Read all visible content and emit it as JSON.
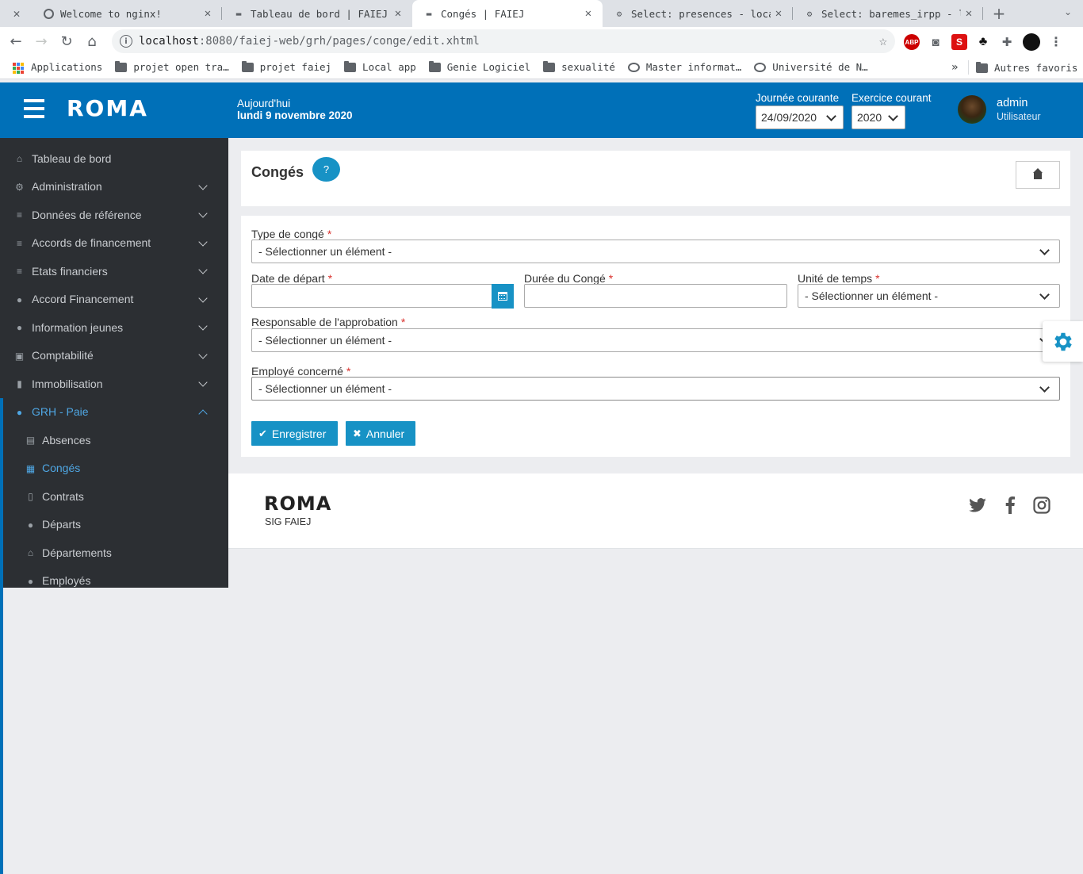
{
  "browser": {
    "tabs": [
      {
        "title": "Welcome to nginx!",
        "active": false
      },
      {
        "title": "Tableau de bord | FAIEJ",
        "active": false
      },
      {
        "title": "Congés | FAIEJ",
        "active": true
      },
      {
        "title": "Select: presences - local",
        "active": false
      },
      {
        "title": "Select: baremes_irpp - lo",
        "active": false
      }
    ],
    "url_host": "localhost",
    "url_rest": ":8080/faiej-web/grh/pages/conge/edit.xhtml",
    "bookmarks": [
      {
        "label": "Applications",
        "icon": "apps-icon"
      },
      {
        "label": "projet open tra…",
        "icon": "folder-icon"
      },
      {
        "label": "projet faiej",
        "icon": "folder-icon"
      },
      {
        "label": "Local app",
        "icon": "folder-icon"
      },
      {
        "label": "Genie Logiciel",
        "icon": "folder-icon"
      },
      {
        "label": "sexualité",
        "icon": "folder-icon"
      },
      {
        "label": "Master informat…",
        "icon": "globe-icon"
      },
      {
        "label": "Université de N…",
        "icon": "globe-icon"
      }
    ],
    "bookmarks_more": "»",
    "other_bookmarks": "Autres favoris",
    "extensions": [
      "ABP",
      "S"
    ]
  },
  "header": {
    "logo": "ROMA",
    "today_label": "Aujourd'hui",
    "today_value": "lundi 9 novembre 2020",
    "journee_label": "Journée courante",
    "journee_value": "24/09/2020",
    "exercice_label": "Exercice courant",
    "exercice_value": "2020",
    "user_name": "admin",
    "user_role": "Utilisateur"
  },
  "sidebar": {
    "items": [
      {
        "label": "Tableau de bord",
        "icon": "home-icon"
      },
      {
        "label": "Administration",
        "icon": "gear-icon"
      },
      {
        "label": "Données de référence",
        "icon": "database-icon"
      },
      {
        "label": "Accords de financement",
        "icon": "database-icon"
      },
      {
        "label": "Etats financiers",
        "icon": "database-icon"
      },
      {
        "label": "Accord Financement",
        "icon": "users-icon"
      },
      {
        "label": "Information jeunes",
        "icon": "users-icon"
      },
      {
        "label": "Comptabilité",
        "icon": "money-icon"
      },
      {
        "label": "Immobilisation",
        "icon": "file-icon"
      },
      {
        "label": "GRH - Paie",
        "icon": "users-icon"
      }
    ],
    "subitems": [
      {
        "label": "Absences",
        "icon": "list-icon"
      },
      {
        "label": "Congés",
        "icon": "calendar-icon"
      },
      {
        "label": "Contrats",
        "icon": "file-icon"
      },
      {
        "label": "Départs",
        "icon": "users-icon"
      },
      {
        "label": "Départements",
        "icon": "home-icon"
      },
      {
        "label": "Employés",
        "icon": "users-icon"
      }
    ]
  },
  "page": {
    "title": "Congés",
    "help": "?"
  },
  "form": {
    "type_label": "Type de congé",
    "type_value": "- Sélectionner un élément -",
    "date_label": "Date de départ",
    "duree_label": "Durée du Congé",
    "unite_label": "Unité de temps",
    "unite_value": "- Sélectionner un élément -",
    "resp_label": "Responsable de l'approbation",
    "resp_value": "- Sélectionner un élément -",
    "employe_label": "Employé concerné",
    "employe_value": "- Sélectionner un élément -",
    "required_mark": "*",
    "save_label": "Enregistrer",
    "cancel_label": "Annuler"
  },
  "footer": {
    "logo": "ROMA",
    "subtitle": "SIG FAIEJ",
    "socials": [
      "twitter-icon",
      "facebook-icon",
      "instagram-icon"
    ]
  },
  "colors": {
    "brand_blue": "#0070b8",
    "button_blue": "#1792c5",
    "sidebar_bg": "#2c2f33",
    "active_link": "#4fa7e4"
  }
}
